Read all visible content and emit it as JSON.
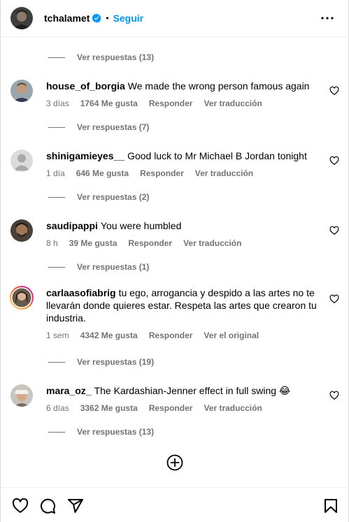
{
  "header": {
    "username": "tchalamet",
    "separator": "•",
    "follow_label": "Seguir",
    "icons": [
      "verified-badge-icon",
      "more-options-icon"
    ]
  },
  "replies_labels": [
    "Ver respuestas (13)",
    "Ver respuestas (7)",
    "Ver respuestas (2)",
    "Ver respuestas (1)",
    "Ver respuestas (19)",
    "Ver respuestas (13)"
  ],
  "comments": [
    {
      "username": "house_of_borgia",
      "text": "We made the wrong person famous again",
      "time": "3 días",
      "likes": "1764 Me gusta",
      "reply": "Responder",
      "translate": "Ver traducción"
    },
    {
      "username": "shinigamieyes__",
      "text": "Good luck to Mr Michael B Jordan tonight",
      "time": "1 día",
      "likes": "646 Me gusta",
      "reply": "Responder",
      "translate": "Ver traducción"
    },
    {
      "username": "saudipappi",
      "text": "You were humbled",
      "time": "8 h",
      "likes": "39 Me gusta",
      "reply": "Responder",
      "translate": "Ver traducción"
    },
    {
      "username": "carlaasofiabrig",
      "text": "tu ego, arrogancia y despido a las artes no te llevarán donde quieres estar. Respeta las artes que crearon tu industria.",
      "time": "1 sem",
      "likes": "4342 Me gusta",
      "reply": "Responder",
      "translate": "Ver el original"
    },
    {
      "username": "mara_oz_",
      "text": "The Kardashian-Jenner effect in full swing 😂",
      "time": "6 días",
      "likes": "3362 Me gusta",
      "reply": "Responder",
      "translate": "Ver traducción"
    }
  ],
  "bottom_icons": [
    "like-icon",
    "comment-icon",
    "share-icon",
    "save-icon",
    "add-comment-icon"
  ],
  "colors": {
    "link": "#0095f6",
    "secondary_text": "#737373",
    "story_ring": "#d6249f"
  }
}
